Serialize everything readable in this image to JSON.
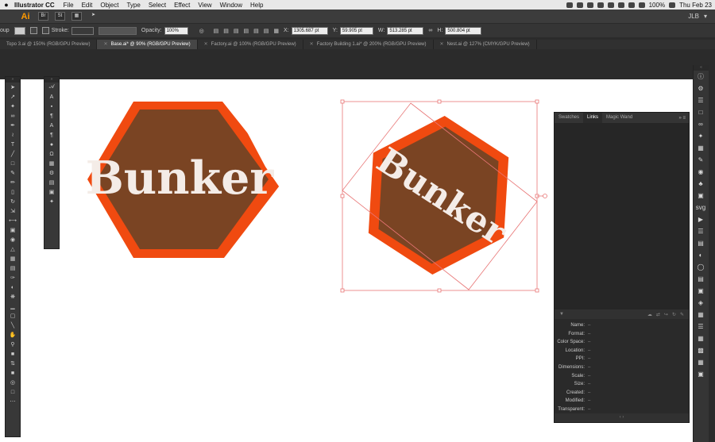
{
  "menubar": {
    "apple": "",
    "app_name": "Illustrator CC",
    "items": [
      "File",
      "Edit",
      "Object",
      "Type",
      "Select",
      "Effect",
      "View",
      "Window",
      "Help"
    ],
    "battery": "100%",
    "clock": "Thu Feb 23"
  },
  "appbar": {
    "logo": "Ai",
    "buttons": [
      "Br",
      "St"
    ],
    "user": "JLB"
  },
  "controlbar": {
    "selection": "oup",
    "stroke_label": "Stroke:",
    "opacity_label": "Opacity:",
    "opacity_value": "100%",
    "x_label": "X:",
    "x_value": "1305.687 pt",
    "y_label": "Y:",
    "y_value": "59.905 pt",
    "w_label": "W:",
    "w_value": "513.285 pt",
    "h_label": "H:",
    "h_value": "500.804 pt"
  },
  "tabs": [
    {
      "label": "Topo 3.ai @ 150% (RGB/GPU Preview)"
    },
    {
      "label": "Base.ai* @ 90% (RGB/GPU Preview)"
    },
    {
      "label": "Factory.ai @ 100% (RGB/GPU Preview)"
    },
    {
      "label": "Factory Building 1.ai* @ 200% (RGB/GPU Preview)"
    },
    {
      "label": "Nest.ai @ 127% (CMYK/GPU Preview)"
    }
  ],
  "artwork": {
    "logo_text": "Bunker",
    "fill_color": "#7a4423",
    "stroke_color": "#f04a10",
    "text_color": "#f4ece7",
    "selection_color": "#e87575"
  },
  "tools_left": [
    "selection-icon",
    "direct-select-icon",
    "magic-wand-icon",
    "lasso-icon",
    "pen-icon",
    "curvature-icon",
    "type-icon",
    "line-icon",
    "rectangle-icon",
    "paintbrush-icon",
    "pencil-icon",
    "eraser-icon",
    "rotate-icon",
    "scale-icon",
    "width-icon",
    "free-transform-icon",
    "shape-builder-icon",
    "perspective-icon",
    "mesh-icon",
    "gradient-icon",
    "eyedropper-icon",
    "blend-icon",
    "symbol-sprayer-icon",
    "graph-icon",
    "artboard-icon",
    "slice-icon",
    "hand-icon",
    "zoom-icon"
  ],
  "tools_right": [
    "type-on-path-icon",
    "touch-type-icon",
    "vertical-type-icon",
    "paragraph-type-icon",
    "character-icon",
    "glyphs-icon",
    "brushes-icon",
    "symbols-icon",
    "gpu-icon",
    "libraries-icon",
    "assets-icon",
    "artboards-icon"
  ],
  "dock_icons": [
    "info-icon",
    "properties-icon",
    "layers-icon",
    "cc-libraries-icon",
    "links-icon",
    "magic-wand-panel-icon",
    "swatches-icon",
    "brushes-panel-icon",
    "color-icon",
    "symbols-panel-icon",
    "graphic-styles-icon",
    "svg-interactivity-icon",
    "actions-icon",
    "stroke-icon",
    "gradient-panel-icon",
    "transparency-icon",
    "appearance-icon",
    "align-icon",
    "transform-icon",
    "pathfinder-icon",
    "character-panel-icon",
    "paragraph-panel-icon",
    "opentype-icon",
    "variables-icon"
  ],
  "panel": {
    "tabs": [
      "Swatches",
      "Links",
      "Magic Wand"
    ],
    "active_tab": "Links",
    "menu": "»  ≡",
    "info_rows": [
      {
        "k": "Name:",
        "v": "–"
      },
      {
        "k": "Format:",
        "v": "–"
      },
      {
        "k": "Color Space:",
        "v": "–"
      },
      {
        "k": "Location:",
        "v": "–"
      },
      {
        "k": "PPI:",
        "v": "–"
      },
      {
        "k": "Dimensions:",
        "v": "–"
      },
      {
        "k": "Scale:",
        "v": "–"
      },
      {
        "k": "Size:",
        "v": "–"
      },
      {
        "k": "Created:",
        "v": "–"
      },
      {
        "k": "Modified:",
        "v": "–"
      },
      {
        "k": "Transparent:",
        "v": "–"
      }
    ],
    "footer": "‹  ›"
  }
}
